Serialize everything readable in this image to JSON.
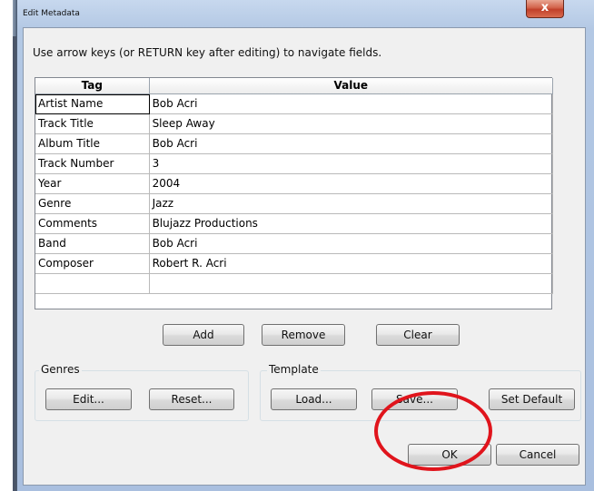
{
  "window": {
    "title": "Edit Metadata",
    "close_symbol": "x"
  },
  "instruction": "Use arrow keys (or RETURN key after editing) to navigate fields.",
  "table": {
    "columns": [
      "Tag",
      "Value"
    ],
    "rows": [
      {
        "tag": "Artist Name",
        "value": "Bob Acri"
      },
      {
        "tag": "Track Title",
        "value": "Sleep Away"
      },
      {
        "tag": "Album Title",
        "value": "Bob Acri"
      },
      {
        "tag": "Track Number",
        "value": "3"
      },
      {
        "tag": "Year",
        "value": "2004"
      },
      {
        "tag": "Genre",
        "value": "Jazz"
      },
      {
        "tag": "Comments",
        "value": "Blujazz Productions"
      },
      {
        "tag": "Band",
        "value": "Bob Acri"
      },
      {
        "tag": "Composer",
        "value": "Robert R. Acri"
      },
      {
        "tag": "",
        "value": ""
      }
    ]
  },
  "row_buttons": {
    "add": "Add",
    "remove": "Remove",
    "clear": "Clear"
  },
  "genres": {
    "label": "Genres",
    "edit": "Edit...",
    "reset": "Reset..."
  },
  "template": {
    "label": "Template",
    "load": "Load...",
    "save": "Save...",
    "set_default": "Set Default"
  },
  "footer": {
    "ok": "OK",
    "cancel": "Cancel"
  },
  "colors": {
    "highlight": "#e0141c"
  }
}
